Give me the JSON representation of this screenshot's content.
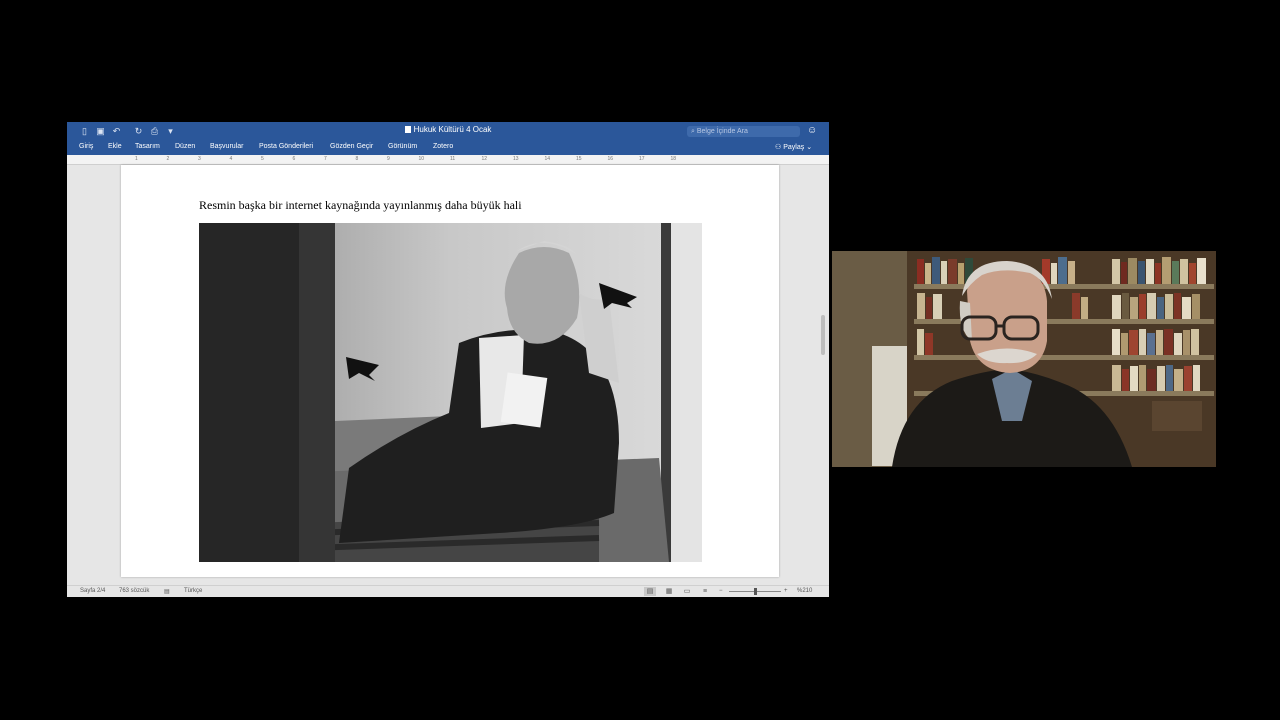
{
  "window": {
    "title": "Hukuk Kültürü 4 Ocak",
    "doc_icon": "word-doc-icon"
  },
  "quick_access": [
    {
      "name": "sidebar-icon",
      "glyph": "▯"
    },
    {
      "name": "save-icon",
      "glyph": "▣"
    },
    {
      "name": "undo-icon",
      "glyph": "↶"
    },
    {
      "name": "redo-icon",
      "glyph": "↻"
    },
    {
      "name": "print-icon",
      "glyph": "⎙"
    },
    {
      "name": "customize-icon",
      "glyph": "▾"
    }
  ],
  "search": {
    "placeholder": "Belge İçinde Ara",
    "icon": "search-icon"
  },
  "smiley_glyph": "☺",
  "tabs": [
    "Giriş",
    "Ekle",
    "Tasarım",
    "Düzen",
    "Başvurular",
    "Posta Gönderileri",
    "Gözden Geçir",
    "Görünüm",
    "Zotero"
  ],
  "share_label": "Paylaş",
  "ruler_numbers": [
    "1",
    "2",
    "3",
    "4",
    "5",
    "6",
    "7",
    "8",
    "9",
    "10",
    "11",
    "12",
    "13",
    "14",
    "15",
    "16",
    "17",
    "18"
  ],
  "document": {
    "caption": "Resmin başka bir internet kaynağında yayınlanmış daha büyük hali"
  },
  "status": {
    "page": "Sayfa 2/4",
    "words": "763 sözcük",
    "language": "Türkçe",
    "zoom_minus": "−",
    "zoom_plus": "+",
    "zoom": "%210",
    "zoom_level": 0.5
  },
  "colors": {
    "ribbon": "#2b579a",
    "page": "#ffffff",
    "background": "#000000"
  }
}
